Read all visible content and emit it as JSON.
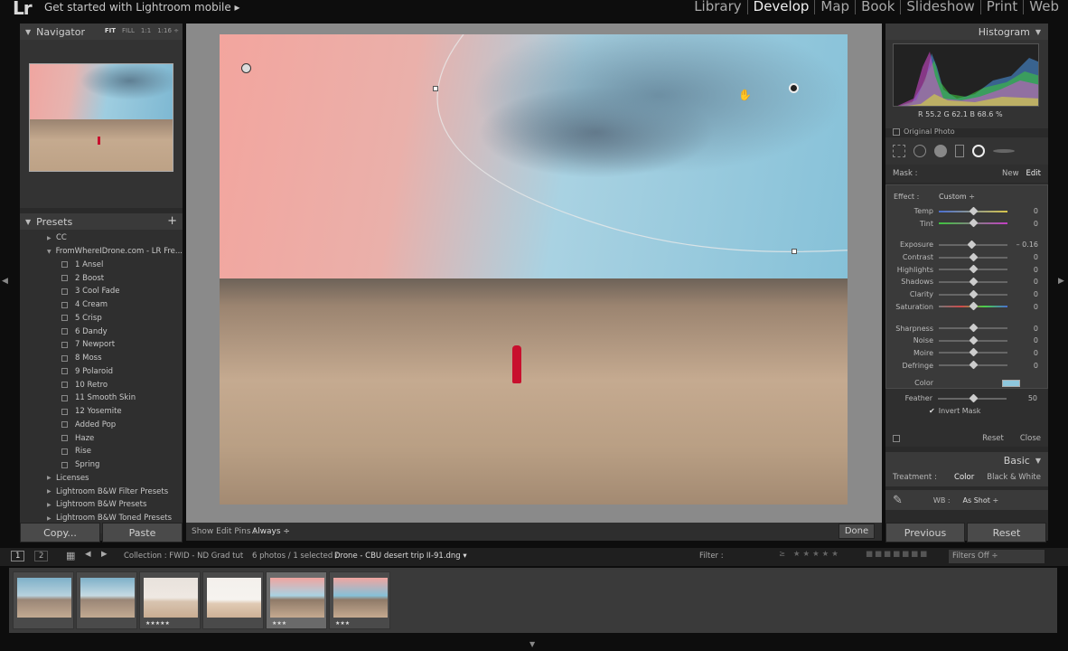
{
  "topbar": {
    "logo": "Lr",
    "mobile_link": "Get started with Lightroom mobile ▸",
    "modules": [
      "Library",
      "Develop",
      "Map",
      "Book",
      "Slideshow",
      "Print",
      "Web"
    ],
    "active_module": "Develop"
  },
  "navigator": {
    "title": "Navigator",
    "zoom_options": [
      "FIT",
      "FILL",
      "1:1",
      "1:16 ÷"
    ]
  },
  "presets": {
    "title": "Presets",
    "items": [
      {
        "label": "CC",
        "level": 1,
        "type": "folder-closed"
      },
      {
        "label": "FromWhereIDrone.com - LR Fre...",
        "level": 1,
        "type": "folder-open"
      },
      {
        "label": "1 Ansel",
        "level": 2,
        "type": "preset"
      },
      {
        "label": "2 Boost",
        "level": 2,
        "type": "preset"
      },
      {
        "label": "3 Cool Fade",
        "level": 2,
        "type": "preset"
      },
      {
        "label": "4 Cream",
        "level": 2,
        "type": "preset"
      },
      {
        "label": "5 Crisp",
        "level": 2,
        "type": "preset"
      },
      {
        "label": "6 Dandy",
        "level": 2,
        "type": "preset"
      },
      {
        "label": "7 Newport",
        "level": 2,
        "type": "preset"
      },
      {
        "label": "8 Moss",
        "level": 2,
        "type": "preset"
      },
      {
        "label": "9 Polaroid",
        "level": 2,
        "type": "preset"
      },
      {
        "label": "10 Retro",
        "level": 2,
        "type": "preset"
      },
      {
        "label": "11 Smooth Skin",
        "level": 2,
        "type": "preset"
      },
      {
        "label": "12 Yosemite",
        "level": 2,
        "type": "preset"
      },
      {
        "label": "Added Pop",
        "level": 2,
        "type": "preset"
      },
      {
        "label": "Haze",
        "level": 2,
        "type": "preset"
      },
      {
        "label": "Rise",
        "level": 2,
        "type": "preset"
      },
      {
        "label": "Spring",
        "level": 2,
        "type": "preset"
      },
      {
        "label": "Licenses",
        "level": 1,
        "type": "folder-closed"
      },
      {
        "label": "Lightroom B&W Filter Presets",
        "level": 1,
        "type": "folder-closed"
      },
      {
        "label": "Lightroom B&W Presets",
        "level": 1,
        "type": "folder-closed"
      },
      {
        "label": "Lightroom B&W Toned Presets",
        "level": 1,
        "type": "folder-closed"
      }
    ]
  },
  "left_buttons": {
    "copy": "Copy...",
    "paste": "Paste"
  },
  "edit_bar": {
    "label": "Show Edit Pins :",
    "value": "Always ÷",
    "done": "Done"
  },
  "histogram": {
    "title": "Histogram",
    "rgb": "R  55.2   G  62.1   B  68.6  %",
    "original_photo": "Original Photo"
  },
  "mask": {
    "label": "Mask :",
    "new": "New",
    "edit": "Edit",
    "effect_label": "Effect :",
    "effect_value": "Custom ÷",
    "sliders": [
      {
        "label": "Temp",
        "value": "0",
        "pos": 0.5
      },
      {
        "label": "Tint",
        "value": "0",
        "pos": 0.5
      },
      {
        "label": "Exposure",
        "value": "– 0.16",
        "pos": 0.48
      },
      {
        "label": "Contrast",
        "value": "0",
        "pos": 0.5
      },
      {
        "label": "Highlights",
        "value": "0",
        "pos": 0.5
      },
      {
        "label": "Shadows",
        "value": "0",
        "pos": 0.5
      },
      {
        "label": "Clarity",
        "value": "0",
        "pos": 0.5
      },
      {
        "label": "Saturation",
        "value": "0",
        "pos": 0.5
      },
      {
        "label": "Sharpness",
        "value": "0",
        "pos": 0.5
      },
      {
        "label": "Noise",
        "value": "0",
        "pos": 0.5
      },
      {
        "label": "Moire",
        "value": "0",
        "pos": 0.5
      },
      {
        "label": "Defringe",
        "value": "0",
        "pos": 0.5
      }
    ],
    "color_label": "Color",
    "color_swatch": "#8ec7dd",
    "feather_label": "Feather",
    "feather_value": "50",
    "feather_pos": 0.5,
    "invert_mask": "Invert Mask",
    "reset": "Reset",
    "close": "Close"
  },
  "basic": {
    "title": "Basic",
    "treatment_label": "Treatment :",
    "color": "Color",
    "bw": "Black & White",
    "wb_label": "WB :",
    "wb_value": "As Shot ÷"
  },
  "right_buttons": {
    "previous": "Previous",
    "reset": "Reset"
  },
  "filmbar": {
    "pages": [
      "1",
      "2"
    ],
    "collection": "Collection : FWID - ND Grad tut",
    "count": "6 photos / 1 selected /",
    "filename": "Drone - CBU desert trip II-91.dng ▾",
    "filter_label": "Filter :",
    "filters_off": "Filters Off ÷"
  },
  "filmstrip": [
    {
      "stars": "",
      "selected": false
    },
    {
      "stars": "",
      "selected": false
    },
    {
      "stars": "★★★★★",
      "selected": false
    },
    {
      "stars": "",
      "selected": false
    },
    {
      "stars": "★★★",
      "selected": true
    },
    {
      "stars": "★★★",
      "selected": false
    }
  ]
}
